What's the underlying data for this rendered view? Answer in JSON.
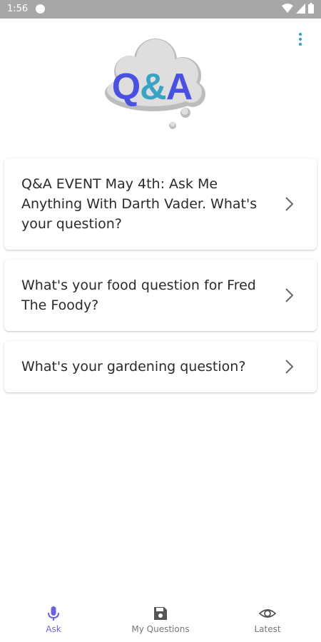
{
  "status_bar": {
    "time": "1:56"
  },
  "header": {
    "logo_q": "Q",
    "logo_amp": "&",
    "logo_a": "A",
    "menu_icon": "kebab-menu-icon"
  },
  "questions": [
    {
      "text": "Q&A EVENT May 4th: Ask Me Anything With Darth Vader. What's your question?"
    },
    {
      "text": "What's your food question for Fred The Foody?"
    },
    {
      "text": "What's your gardening question?"
    }
  ],
  "bottom_nav": {
    "ask_label": "Ask",
    "my_questions_label": "My Questions",
    "latest_label": "Latest",
    "active": "Ask"
  },
  "colors": {
    "accent": "#6a63d9",
    "logo_blue": "#4a50e0",
    "logo_teal": "#39a3c6",
    "menu_dots": "#2aa0c8",
    "status_bar": "#a7a7a7"
  }
}
